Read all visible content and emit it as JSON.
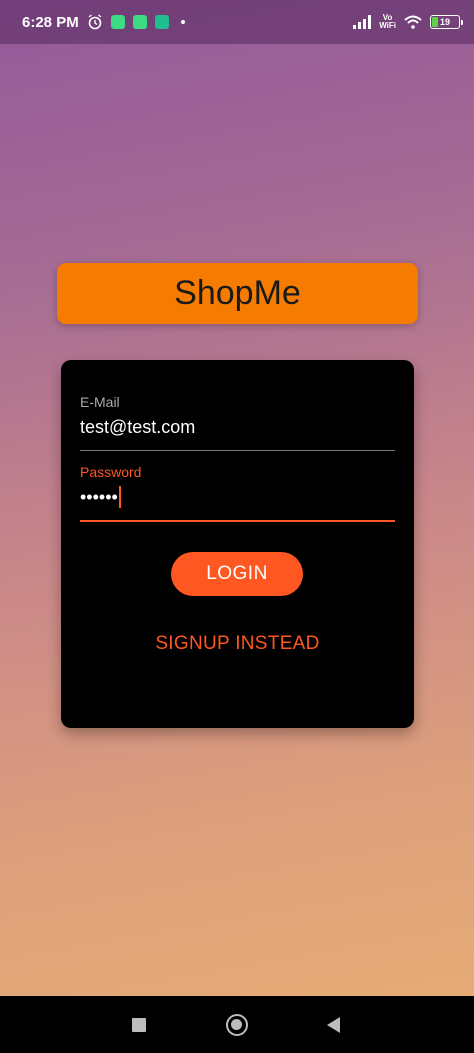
{
  "status_bar": {
    "time": "6:28 PM",
    "icons": [
      "alarm-icon",
      "app-notification-icon",
      "app-notification-icon",
      "shield-app-icon",
      "more-dot-icon"
    ],
    "network_label_top": "Vo",
    "network_label_bottom": "WiFi",
    "battery_level": "19"
  },
  "brand": {
    "title": "ShopMe"
  },
  "login_form": {
    "email": {
      "label": "E-Mail",
      "value": "test@test.com"
    },
    "password": {
      "label": "Password",
      "masked_value": "••••••"
    },
    "login_label": "LOGIN",
    "signup_label": "SIGNUP INSTEAD"
  },
  "colors": {
    "brand_orange": "#f57c00",
    "accent": "#ff5722",
    "card_background": "#000000"
  },
  "nav_bar": {
    "buttons": [
      "recents-square-icon",
      "home-circle-icon",
      "back-triangle-icon"
    ]
  }
}
